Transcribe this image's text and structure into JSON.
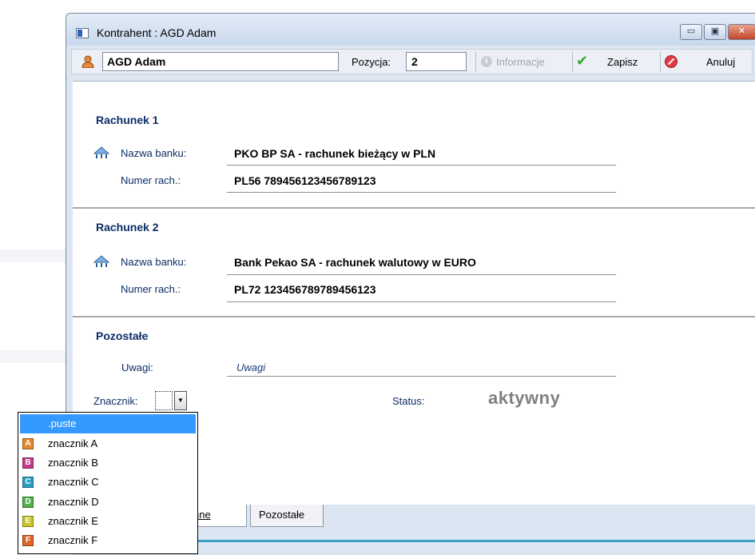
{
  "window": {
    "title": "Kontrahent : AGD Adam"
  },
  "window_controls": {
    "minimize": "▭",
    "maximize": "▣",
    "close": "✕"
  },
  "toolbar": {
    "name_value": "AGD Adam",
    "position_label": "Pozycja:",
    "position_value": "2",
    "info_label": "Informacje",
    "save_label": "Zapisz",
    "cancel_label": "Anuluj",
    "user_icon": "user-icon",
    "info_icon_glyph": "i",
    "save_icon_glyph": "✔"
  },
  "account1": {
    "title": "Rachunek 1",
    "bank_label": "Nazwa banku:",
    "bank_value": "PKO BP SA - rachunek bieżący w PLN",
    "number_label": "Numer rach.:",
    "number_value": "PL56 789456123456789123"
  },
  "account2": {
    "title": "Rachunek 2",
    "bank_label": "Nazwa banku:",
    "bank_value": "Bank Pekao SA - rachunek walutowy w EURO",
    "number_label": "Numer rach.:",
    "number_value": "PL72 123456789789456123"
  },
  "other": {
    "title": "Pozostałe",
    "notes_label": "Uwagi:",
    "notes_value": "Uwagi",
    "marker_label": "Znacznik:",
    "marker_arrow": "▼",
    "status_label": "Status:",
    "status_value": "aktywny"
  },
  "tabs": [
    {
      "label": "nne",
      "active": true
    },
    {
      "label": "Pozostałe",
      "active": false
    }
  ],
  "marker_dropdown": {
    "options": [
      {
        "label": ".puste",
        "badge": "",
        "color": "",
        "selected": true
      },
      {
        "label": "znacznik A",
        "badge": "A",
        "color": "#e08a2a",
        "selected": false
      },
      {
        "label": "znacznik B",
        "badge": "B",
        "color": "#c43a8a",
        "selected": false
      },
      {
        "label": "znacznik C",
        "badge": "C",
        "color": "#2a9ec4",
        "selected": false
      },
      {
        "label": "znacznik D",
        "badge": "D",
        "color": "#52b04a",
        "selected": false
      },
      {
        "label": "znacznik E",
        "badge": "E",
        "color": "#c8c42a",
        "selected": false
      },
      {
        "label": "znacznik F",
        "badge": "F",
        "color": "#e0642a",
        "selected": false
      }
    ]
  },
  "colors": {
    "window_bg": "#dce6f2",
    "section_title": "#0c2d66",
    "selection": "#3399ff",
    "status_text": "#808080",
    "accent_line": "#3aa0c4"
  }
}
